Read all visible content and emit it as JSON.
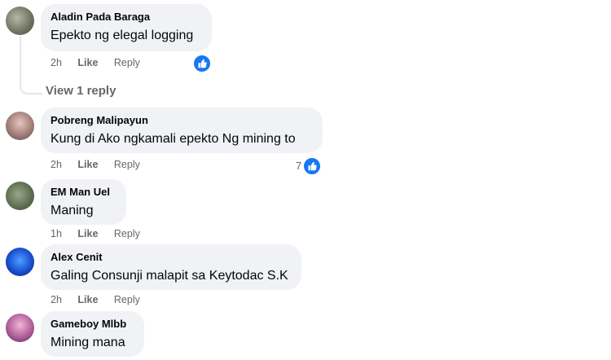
{
  "comments": [
    {
      "author": "Aladin Pada Baraga",
      "text": "Epekto ng elegal logging",
      "time": "2h",
      "like": "Like",
      "reply": "Reply",
      "reaction_count": ""
    },
    {
      "author": "Pobreng Malipayun",
      "text": "Kung di Ako ngkamali epekto Ng mining to",
      "time": "2h",
      "like": "Like",
      "reply": "Reply",
      "reaction_count": "7"
    },
    {
      "author": "EM Man Uel",
      "text": "Maning",
      "time": "1h",
      "like": "Like",
      "reply": "Reply",
      "reaction_count": ""
    },
    {
      "author": "Alex Cenit",
      "text": "Galing Consunji malapit sa Keytodac S.K",
      "time": "2h",
      "like": "Like",
      "reply": "Reply",
      "reaction_count": ""
    },
    {
      "author": "Gameboy Mlbb",
      "text": "Mining mana",
      "time": "",
      "like": "",
      "reply": "",
      "reaction_count": ""
    }
  ],
  "view_reply": "View 1 reply",
  "icons": {
    "reaction": "like-thumb-icon"
  },
  "colors": {
    "reaction": "#1877f2",
    "bubble": "#f0f2f5",
    "meta": "#65676b"
  }
}
